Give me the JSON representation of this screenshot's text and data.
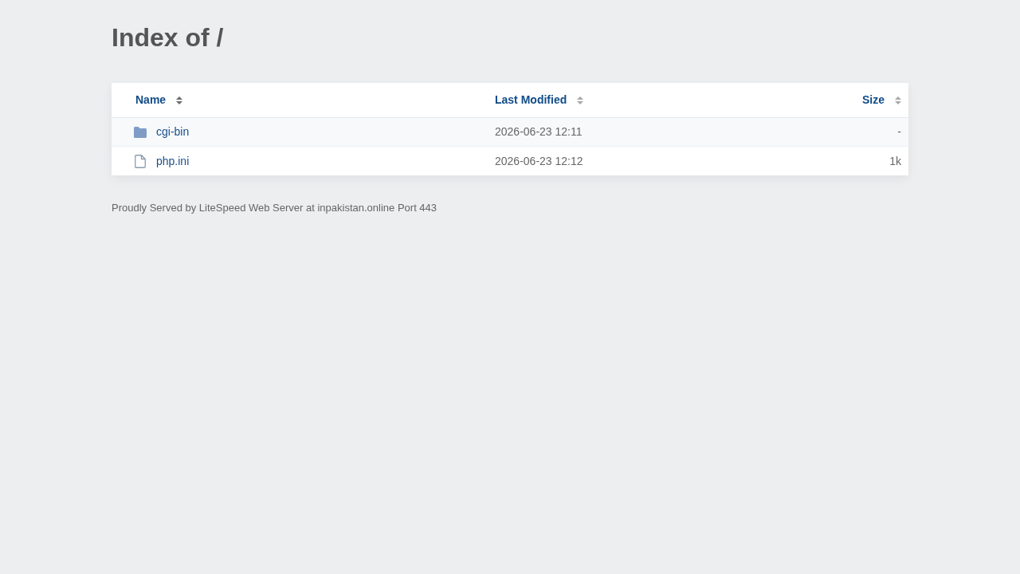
{
  "title": "Index of /",
  "table": {
    "columns": [
      {
        "label": "Name",
        "selected": true
      },
      {
        "label": "Last Modified",
        "selected": false
      },
      {
        "label": "Size",
        "selected": false
      }
    ],
    "rows": [
      {
        "kind": "folder",
        "name": "cgi-bin",
        "last_modified": "2026-06-23 12:11",
        "size": "-"
      },
      {
        "kind": "file",
        "name": "php.ini",
        "last_modified": "2026-06-23 12:12",
        "size": "1k"
      }
    ]
  },
  "footer": "Proudly Served by LiteSpeed Web Server at inpakistan.online Port 443"
}
